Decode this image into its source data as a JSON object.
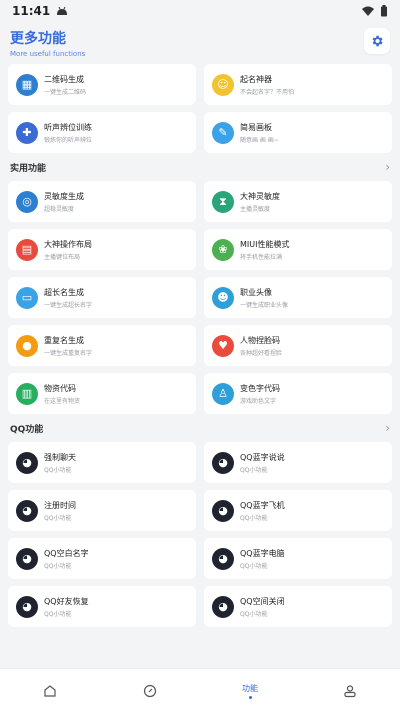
{
  "status": {
    "time": "11:41"
  },
  "header": {
    "title": "更多功能",
    "subtitle": "More useful functions"
  },
  "top_items": [
    {
      "title": "二维码生成",
      "sub": "一键生成二维码",
      "icon": "qrcode-icon",
      "color": "#2f7fd1"
    },
    {
      "title": "起名神器",
      "sub": "不会起名字？不用怕",
      "icon": "emoji-icon",
      "color": "#2a8ef0"
    },
    {
      "title": "听声辨位训练",
      "sub": "锻炼你的听声辨位",
      "icon": "gamepad-icon",
      "color": "#3b6cd6"
    },
    {
      "title": "简易画板",
      "sub": "随意画 画 画~",
      "icon": "brush-icon",
      "color": "#3aa3e8"
    }
  ],
  "sections": [
    {
      "title": "实用功能",
      "items": [
        {
          "title": "灵敏度生成",
          "sub": "超稳灵敏度",
          "icon": "target-icon",
          "color": "#2f7fd1"
        },
        {
          "title": "大神灵敏度",
          "sub": "主播灵敏度",
          "icon": "hourglass-icon",
          "color": "#2aa57a"
        },
        {
          "title": "大神操作布局",
          "sub": "主播键位布局",
          "icon": "layout-icon",
          "color": "#e64b3c"
        },
        {
          "title": "MIUI性能模式",
          "sub": "将手机性能拉满",
          "icon": "leaf-icon",
          "color": "#4caf50"
        },
        {
          "title": "超长名生成",
          "sub": "一键生成超长名字",
          "icon": "monitor-icon",
          "color": "#3aa3e8"
        },
        {
          "title": "职业头像",
          "sub": "一键生成职业头像",
          "icon": "avatar-icon",
          "color": "#2f9fd9"
        },
        {
          "title": "重复名生成",
          "sub": "一键生成重复名字",
          "icon": "pumpkin-icon",
          "color": "#f39c12"
        },
        {
          "title": "人物捏脸码",
          "sub": "各种超好看捏脸",
          "icon": "balloon-icon",
          "color": "#e74c3c"
        },
        {
          "title": "物资代码",
          "sub": "在这里有物资",
          "icon": "chart-icon",
          "color": "#27ae60"
        },
        {
          "title": "变色字代码",
          "sub": "游戏助色文字",
          "icon": "person-icon",
          "color": "#2f9fd9"
        }
      ]
    },
    {
      "title": "QQ功能",
      "items": [
        {
          "title": "强制聊天",
          "sub": "QQ小功能",
          "icon": "qq-penguin-icon"
        },
        {
          "title": "QQ蓝字说说",
          "sub": "QQ小功能",
          "icon": "qq-penguin-icon"
        },
        {
          "title": "注册时间",
          "sub": "QQ小功能",
          "icon": "qq-penguin-icon"
        },
        {
          "title": "QQ蓝字飞机",
          "sub": "QQ小功能",
          "icon": "qq-penguin-icon"
        },
        {
          "title": "QQ空白名字",
          "sub": "QQ小功能",
          "icon": "qq-penguin-icon"
        },
        {
          "title": "QQ蓝字电脑",
          "sub": "QQ小功能",
          "icon": "qq-penguin-icon"
        },
        {
          "title": "QQ好友恢复",
          "sub": "QQ小功能",
          "icon": "qq-penguin-icon"
        },
        {
          "title": "QQ空间关闭",
          "sub": "QQ小功能",
          "icon": "qq-penguin-icon"
        }
      ]
    }
  ],
  "nav": [
    {
      "name": "home-icon",
      "label": ""
    },
    {
      "name": "compass-icon",
      "label": ""
    },
    {
      "name": "functions-tab",
      "label": "功能"
    },
    {
      "name": "profile-icon",
      "label": ""
    }
  ],
  "colors": {
    "accent": "#3a6bd8",
    "background": "#f3f4f6"
  }
}
